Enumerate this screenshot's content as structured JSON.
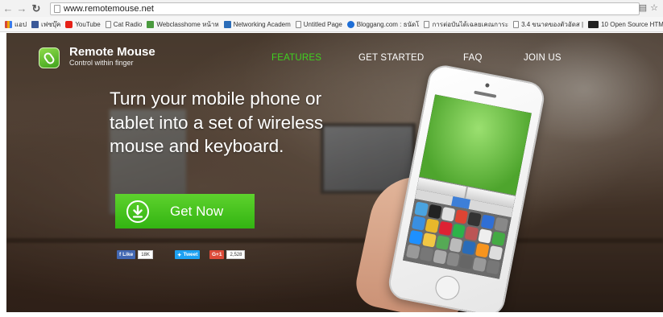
{
  "browser": {
    "url": "www.remotemouse.net",
    "bookmarks": [
      {
        "icon": "apps-icon",
        "label": "แอป"
      },
      {
        "icon": "facebook-icon",
        "label": "เฟซบุ๊ค"
      },
      {
        "icon": "youtube-icon",
        "label": "YouTube"
      },
      {
        "icon": "page-icon",
        "label": "Cat Radio"
      },
      {
        "icon": "webclass-icon",
        "label": "Webclasshome หน้าห"
      },
      {
        "icon": "networking-icon",
        "label": "Networking Academ"
      },
      {
        "icon": "page-icon",
        "label": "Untitled Page"
      },
      {
        "icon": "bloggang-icon",
        "label": "Bloggang.com : ธนัดโ"
      },
      {
        "icon": "page-icon",
        "label": "การต่อบันได้เฉลยเคณการะ"
      },
      {
        "icon": "page-icon",
        "label": "3.4 ขนาดของตัวอัดส |"
      },
      {
        "icon": "sw-icon",
        "label": "10 Open Source HTM"
      }
    ]
  },
  "site": {
    "brand_name": "Remote Mouse",
    "brand_tagline": "Control within finger",
    "nav": [
      {
        "label": "FEATURES",
        "active": true
      },
      {
        "label": "GET STARTED",
        "active": false
      },
      {
        "label": "FAQ",
        "active": false
      },
      {
        "label": "JOIN US",
        "active": false
      }
    ],
    "headline": "Turn your mobile phone or tablet into a set of wireless mouse and keyboard.",
    "cta_label": "Get Now",
    "social": {
      "facebook_label": "Like",
      "facebook_count": "18K",
      "twitter_label": "Tweet",
      "gplus_label": "G+1",
      "gplus_count": "2,528"
    }
  },
  "colors": {
    "accent": "#3fd21f",
    "cta": "#45c21f",
    "facebook": "#4267b2",
    "twitter": "#1da1f2",
    "gplus": "#dd4b39"
  }
}
